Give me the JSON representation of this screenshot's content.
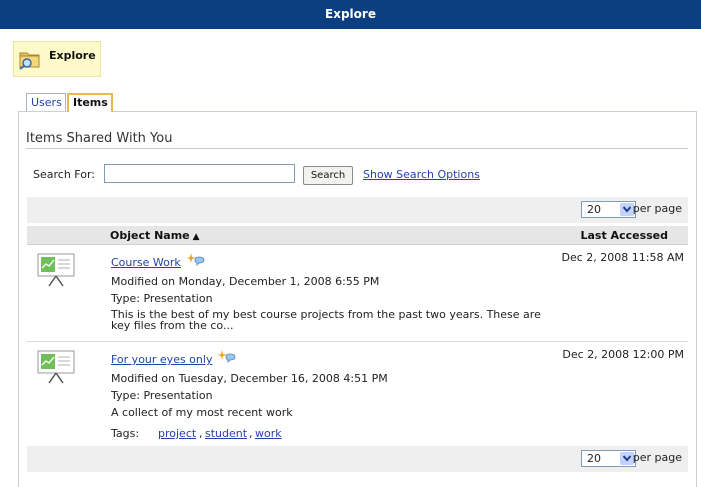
{
  "header": {
    "title": "Explore"
  },
  "toolbar": {
    "explore_label": "Explore"
  },
  "tabs": [
    {
      "label": "Users",
      "active": false
    },
    {
      "label": "Items",
      "active": true
    }
  ],
  "section": {
    "title": "Items Shared With You"
  },
  "search": {
    "label": "Search For:",
    "value": "",
    "button_label": "Search",
    "options_link": "Show Search Options"
  },
  "pagination": {
    "per_page_value": "20",
    "per_page_label": "per page"
  },
  "table": {
    "columns": {
      "name": "Object Name",
      "sort_glyph": "▲",
      "accessed": "Last Accessed"
    },
    "rows": [
      {
        "name": "Course Work",
        "modified": "Modified on Monday, December 1, 2008 6:55 PM",
        "type": "Type: Presentation",
        "description": "This is the best of my best course projects from the past two years. These are key files from the co...",
        "last_accessed": "Dec 2, 2008 11:58 AM"
      },
      {
        "name": "For your eyes only",
        "modified": "Modified on Tuesday, December 16, 2008 4:51 PM",
        "type": "Type: Presentation",
        "description": "A collect of my most recent work",
        "last_accessed": "Dec 2, 2008 12:00 PM",
        "tags_label": "Tags:",
        "tags": [
          "project",
          "student",
          "work"
        ]
      }
    ]
  },
  "icons": {
    "explore": "folder-magnifier-icon",
    "thumbnail": "presentation-easel-icon",
    "shared": "shared-sparkle-icon",
    "dropdown": "chevron-down-icon"
  },
  "colors": {
    "titlebar": "#0b3f7f",
    "link": "#2244aa",
    "explore_bg": "#fdf9c8",
    "active_tab_border": "#e9b84e"
  }
}
